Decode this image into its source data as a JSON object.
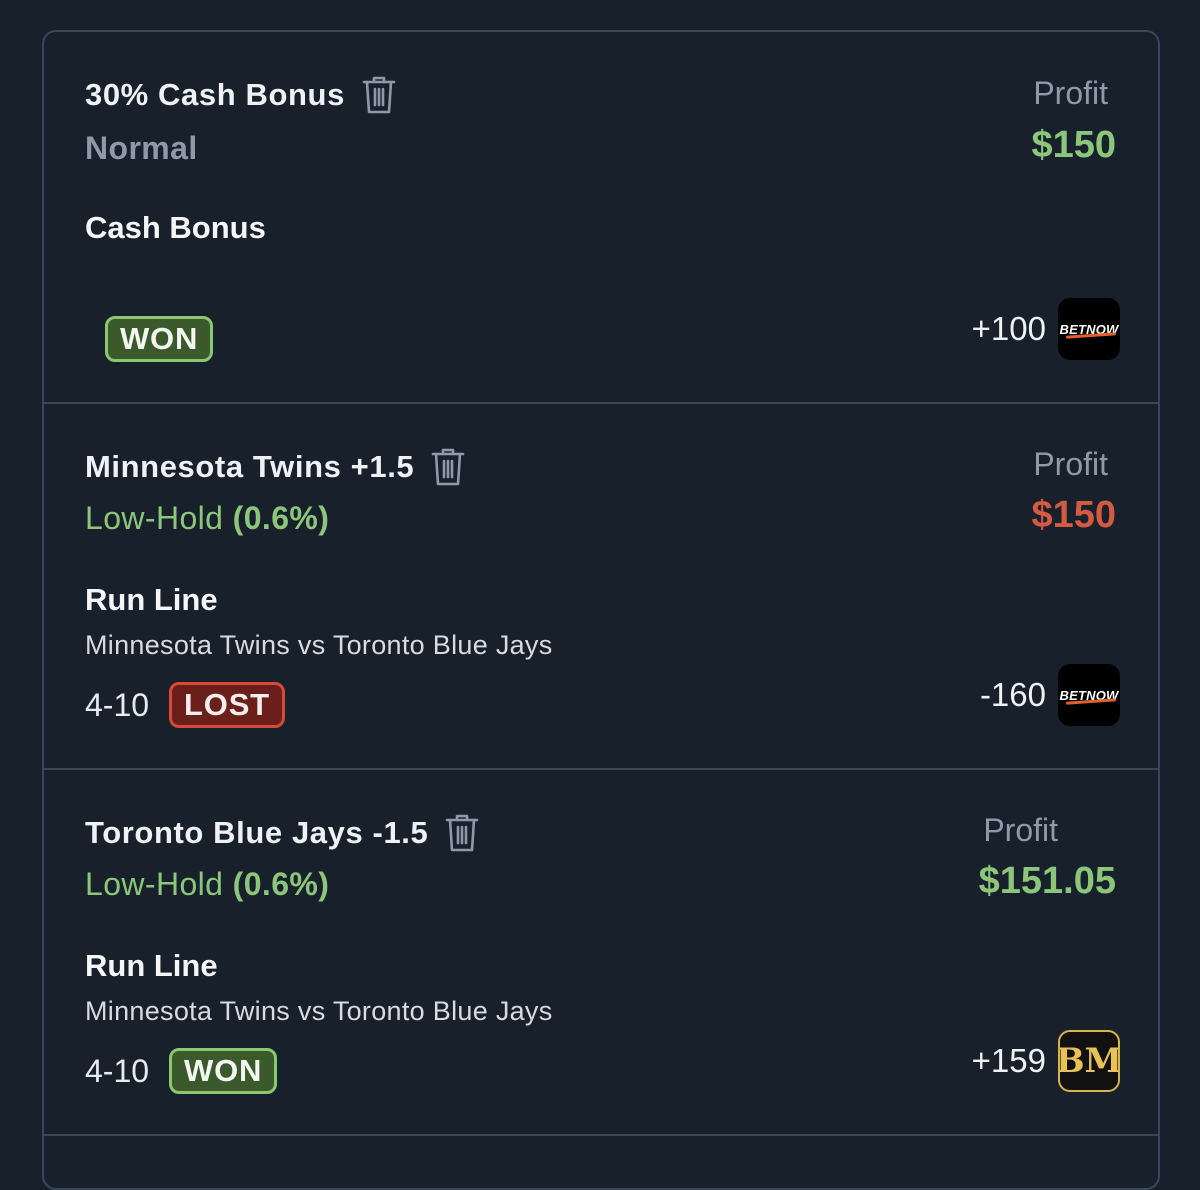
{
  "colors": {
    "background": "#18212b",
    "border": "#39475a",
    "profit_positive": "#8bc67a",
    "profit_negative": "#d45a42",
    "muted": "#8f9aa8"
  },
  "cards": [
    {
      "title": "30% Cash Bonus",
      "subtitle": "Normal",
      "market": "Cash Bonus",
      "profit_label": "Profit",
      "profit_value": "$150",
      "result": "WON",
      "odds": "+100",
      "book_icon": "betnow-logo",
      "book_text": "BETNOW"
    },
    {
      "title": "Minnesota Twins +1.5",
      "subtitle": "Low-Hold",
      "subtitle_pct": "(0.6%)",
      "market": "Run Line",
      "event": "Minnesota Twins vs Toronto Blue Jays",
      "score": "4-10",
      "profit_label": "Profit",
      "profit_value": "$150",
      "result": "LOST",
      "odds": "-160",
      "book_icon": "betnow-logo",
      "book_text": "BETNOW"
    },
    {
      "title": "Toronto Blue Jays -1.5",
      "subtitle": "Low-Hold",
      "subtitle_pct": "(0.6%)",
      "market": "Run Line",
      "event": "Minnesota Twins vs Toronto Blue Jays",
      "score": "4-10",
      "profit_label": "Profit",
      "profit_value": "$151.05",
      "result": "WON",
      "odds": "+159",
      "book_icon": "bookmaker-logo",
      "book_text": "BM"
    }
  ]
}
